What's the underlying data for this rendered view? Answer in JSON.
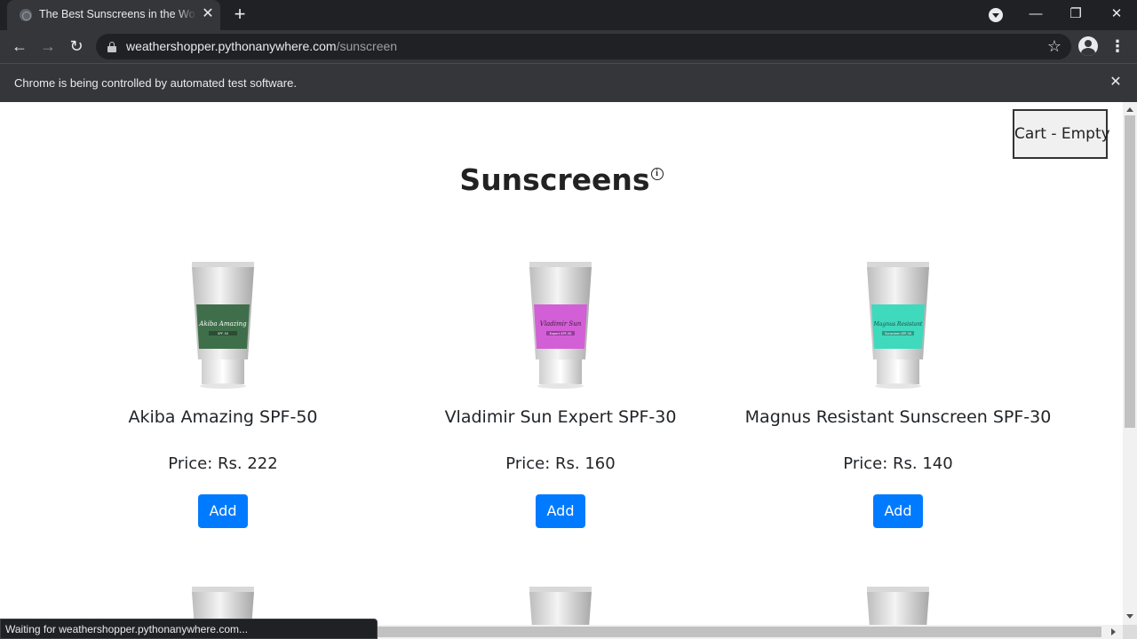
{
  "browser": {
    "tab": {
      "title": "The Best Sunscreens in the World",
      "close": "✕"
    },
    "new_tab": "+",
    "window": {
      "minimize": "—",
      "restore": "❐",
      "close": "✕"
    },
    "nav": {
      "back": "←",
      "forward": "→",
      "reload": "↻"
    },
    "url_host": "weathershopper.pythonanywhere.com",
    "url_path": "/sunscreen",
    "bookmark": "☆",
    "menu": "⋮",
    "infobar_text": "Chrome is being controlled by automated test software.",
    "infobar_close": "✕",
    "status_text": "Waiting for weathershopper.pythonanywhere.com..."
  },
  "page": {
    "cart_label": "Cart - Empty",
    "title": "Sunscreens",
    "info_icon": "i",
    "products": [
      {
        "name": "Akiba Amazing SPF-50",
        "price": "Price: Rs. 222",
        "add_label": "Add",
        "band_color": "#3f6f4a",
        "band_text": "Akiba Amazing",
        "band_sub": "SPF-50"
      },
      {
        "name": "Vladimir Sun Expert SPF-30",
        "price": "Price: Rs. 160",
        "add_label": "Add",
        "band_color": "#d35fd6",
        "band_text": "Vladimir Sun",
        "band_sub": "Expert SPF-30"
      },
      {
        "name": "Magnus Resistant Sunscreen SPF-30",
        "price": "Price: Rs. 140",
        "add_label": "Add",
        "band_color": "#3fd9bd",
        "band_text": "Magnus Resistant",
        "band_sub": "Sunscreen SPF-30"
      }
    ]
  },
  "colors": {
    "accent": "#007bff",
    "chrome_dark": "#202124",
    "chrome_toolbar": "#35363a"
  }
}
